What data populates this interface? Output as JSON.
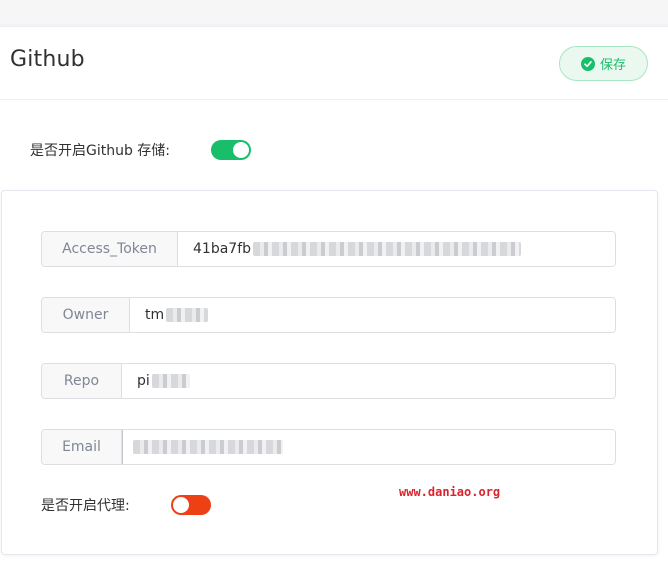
{
  "header": {
    "title": "Github",
    "save_label": "保存"
  },
  "github_enable": {
    "label": "是否开启Github 存储:",
    "enabled": true
  },
  "form": {
    "access_token": {
      "label": "Access_Token",
      "value": "41ba7fb"
    },
    "owner": {
      "label": "Owner",
      "value": "tm"
    },
    "repo": {
      "label": "Repo",
      "value": "pi"
    },
    "email": {
      "label": "Email",
      "value": ""
    }
  },
  "proxy_enable": {
    "label": "是否开启代理:",
    "enabled": false
  },
  "watermark": "www.daniao.org",
  "colors": {
    "success": "#19be6b",
    "danger": "#ed4014",
    "watermark": "#d9232d"
  }
}
